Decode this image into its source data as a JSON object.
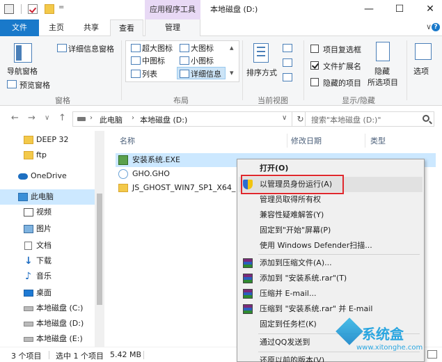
{
  "titlebar": {
    "context_tab_group": "应用程序工具",
    "title": "本地磁盘 (D:)",
    "min_glyph": "—",
    "max_glyph": "☐",
    "close_glyph": "✕",
    "qa_dropdown": "="
  },
  "tabs": {
    "file": "文件",
    "home": "主页",
    "share": "共享",
    "view": "查看",
    "manage": "管理",
    "collapse_glyph": "∨",
    "help_glyph": "?"
  },
  "ribbon": {
    "panes": {
      "nav_pane": "导航窗格",
      "preview_pane": "预览窗格",
      "details_pane": "详细信息窗格",
      "group_label": "窗格"
    },
    "layout": {
      "extra_large": "超大图标",
      "large": "大图标",
      "medium": "中图标",
      "small": "小图标",
      "list": "列表",
      "details": "详细信息",
      "group_label": "布局"
    },
    "current_view": {
      "sort_by": "排序方式",
      "group_label": "当前视图"
    },
    "show_hide": {
      "item_checkboxes": "项目复选框",
      "item_checkboxes_checked": false,
      "file_extensions": "文件扩展名",
      "file_extensions_checked": true,
      "hidden_items": "隐藏的项目",
      "hidden_items_checked": false,
      "hide_selected_1": "隐藏",
      "hide_selected_2": "所选项目",
      "group_label": "显示/隐藏"
    },
    "options": "选项"
  },
  "navbar": {
    "back": "←",
    "forward": "→",
    "recent": "∨",
    "up": "↑",
    "crumb_pc": "此电脑",
    "crumb_drive": "本地磁盘 (D:)",
    "chev": "›",
    "dropdown": "∨",
    "refresh": "↻",
    "search_placeholder": "搜索\"本地磁盘 (D:)\""
  },
  "nav_pane": {
    "items": [
      {
        "label": "DEEP 32"
      },
      {
        "label": "ftp"
      },
      {
        "label": "OneDrive"
      },
      {
        "label": "此电脑"
      },
      {
        "label": "视频"
      },
      {
        "label": "图片"
      },
      {
        "label": "文档"
      },
      {
        "label": "下载"
      },
      {
        "label": "音乐"
      },
      {
        "label": "桌面"
      },
      {
        "label": "本地磁盘 (C:)"
      },
      {
        "label": "本地磁盘 (D:)"
      },
      {
        "label": "本地磁盘 (E:)"
      }
    ]
  },
  "file_list": {
    "columns": {
      "name": "名称",
      "date": "修改日期",
      "type": "类型"
    },
    "rows": [
      {
        "name": "安装系统.EXE"
      },
      {
        "name": "GHO.GHO"
      },
      {
        "name": "JS_GHOST_WIN7_SP1_X64_"
      }
    ]
  },
  "context_menu": {
    "items": [
      "打开(O)",
      "以管理员身份运行(A)",
      "管理员取得所有权",
      "兼容性疑难解答(Y)",
      "固定到\"开始\"屏幕(P)",
      "使用 Windows Defender扫描...",
      "添加到压缩文件(A)...",
      "添加到 \"安装系统.rar\"(T)",
      "压缩并 E-mail...",
      "压缩到 \"安装系统.rar\" 并 E-mail",
      "固定到任务栏(K)",
      "通过QQ发送到",
      "还原以前的版本(V)"
    ]
  },
  "statusbar": {
    "count": "3 个项目",
    "selection": "选中 1 个项目",
    "size": "5.42 MB"
  },
  "watermark": {
    "title": "系统盒",
    "url": "www.xitonghe.com"
  },
  "colors": {
    "accent": "#1979ca",
    "context_tab": "#e8d9f5",
    "selection": "#cce8ff",
    "highlight_box": "#e0282d"
  }
}
